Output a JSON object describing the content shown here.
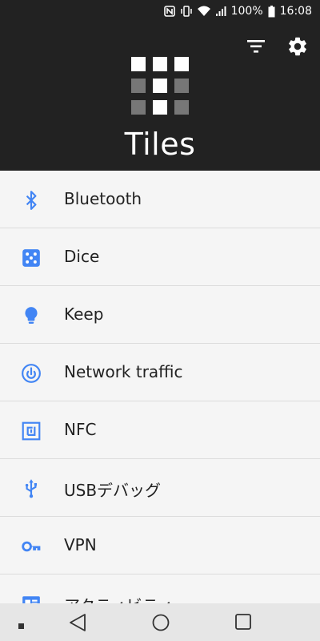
{
  "status_bar": {
    "battery": "100%",
    "time": "16:08",
    "icons": [
      "nfc-icon",
      "vibrate-icon",
      "wifi-icon",
      "signal-icon",
      "battery-icon"
    ]
  },
  "header": {
    "title": "Tiles",
    "background": "#222222",
    "actions": [
      "filter-icon",
      "settings-gear-icon"
    ]
  },
  "accent_color": "#4285f4",
  "tiles": [
    {
      "label": "Bluetooth",
      "icon": "bluetooth-icon"
    },
    {
      "label": "Dice",
      "icon": "dice-icon"
    },
    {
      "label": "Keep",
      "icon": "lightbulb-icon"
    },
    {
      "label": "Network traffic",
      "icon": "network-traffic-icon"
    },
    {
      "label": "NFC",
      "icon": "nfc-icon"
    },
    {
      "label": "USBデバッグ",
      "icon": "usb-icon"
    },
    {
      "label": "VPN",
      "icon": "key-icon"
    },
    {
      "label": "アクティビティ",
      "icon": "activity-icon"
    }
  ],
  "nav_bar": {
    "buttons": [
      "square-dot-icon",
      "back-icon",
      "home-icon",
      "recents-icon"
    ]
  }
}
